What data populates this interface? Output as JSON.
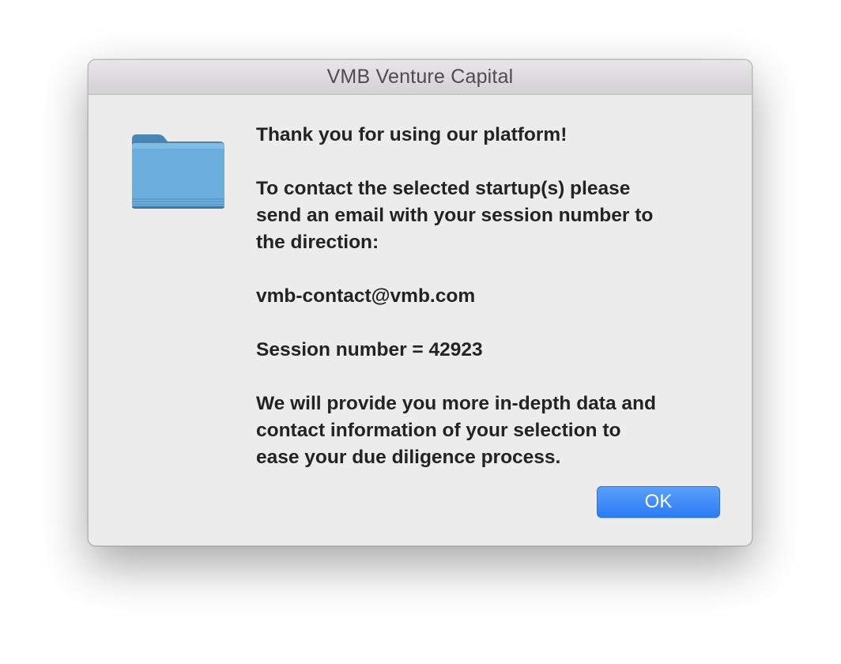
{
  "window": {
    "title": "VMB Venture Capital"
  },
  "icon": {
    "name": "folder-icon",
    "color": "#6aaedb"
  },
  "message": {
    "heading": "Thank you for using our platform!",
    "contact_lines": [
      "To contact the selected startup(s) please",
      "send an email with your session number to",
      "the direction:"
    ],
    "email": "vmb-contact@vmb.com",
    "session": "Session number = 42923",
    "closing_lines": [
      "We will provide you more in-depth data and",
      "contact information of your selection to",
      "ease your due diligence process."
    ]
  },
  "buttons": {
    "ok_label": "OK"
  },
  "colors": {
    "accent": "#2b7cf5",
    "dialog_background": "#ececec"
  }
}
